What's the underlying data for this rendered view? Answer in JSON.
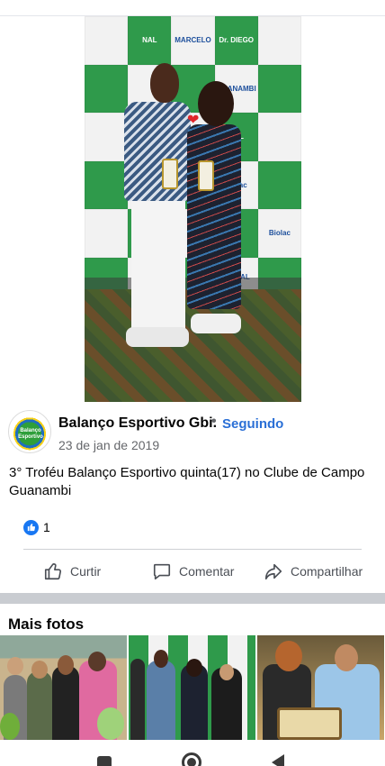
{
  "post": {
    "author_name": "Balanço Esportivo Gbi.",
    "separator": "•",
    "follow_status": "Seguindo",
    "date": "23 de jan de 2019",
    "caption": "3° Troféu Balanço Esportivo quinta(17) no Clube de Campo Guanambi",
    "reaction_count": "1",
    "avatar_text": "Balanço Esportivo"
  },
  "actions": {
    "like_label": "Curtir",
    "comment_label": "Comentar",
    "share_label": "Compartilhar"
  },
  "more_photos": {
    "title": "Mais fotos"
  },
  "photo_backdrop_labels": [
    "NAL",
    "MARCELO",
    "Dr. DIEGO",
    "GUANAMBI",
    "Biolac",
    "CENTRAL MOTOS",
    "NAL",
    "Biolac"
  ],
  "colors": {
    "accent": "#2a6fd6",
    "like_badge": "#1877f2",
    "muted_text": "#65676b",
    "section_gap": "#c9ccd1"
  },
  "icons": {
    "like": "thumbs-up-icon",
    "comment": "comment-bubble-icon",
    "share": "share-arrow-icon",
    "nav_recents": "recents-square-icon",
    "nav_home": "home-circle-icon",
    "nav_back": "back-triangle-icon"
  }
}
